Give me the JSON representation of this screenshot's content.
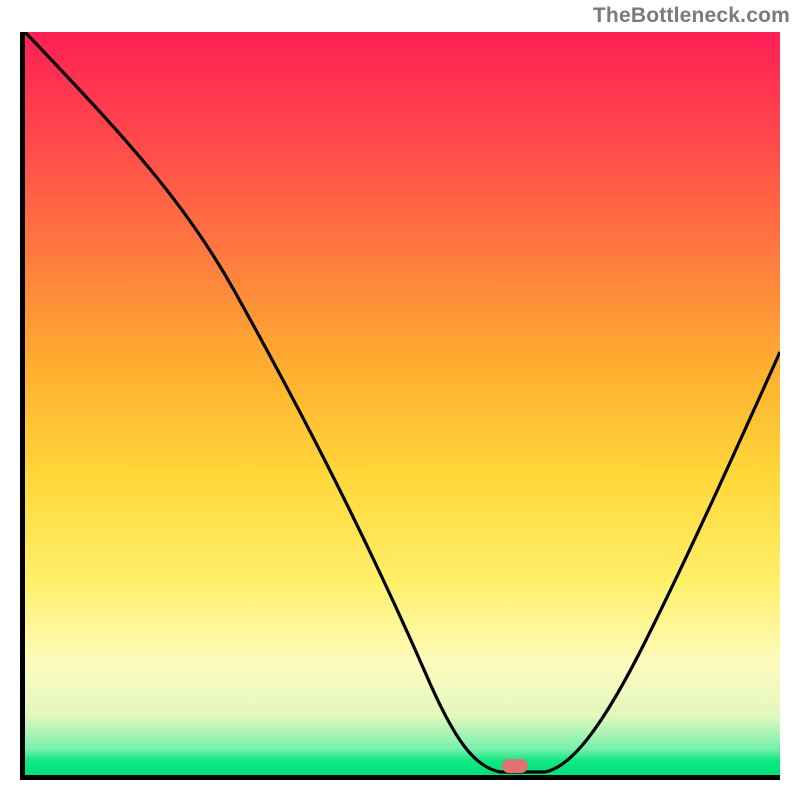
{
  "watermark": "TheBottleneck.com",
  "chart_data": {
    "type": "line",
    "title": "",
    "xlabel": "",
    "ylabel": "",
    "xlim": [
      0,
      100
    ],
    "ylim": [
      0,
      100
    ],
    "x": [
      0,
      10,
      20,
      30,
      40,
      50,
      58,
      62,
      65,
      68,
      72,
      80,
      90,
      100
    ],
    "values": [
      100,
      88,
      76,
      60,
      43,
      26,
      8,
      1,
      0,
      0,
      3,
      18,
      37,
      58
    ],
    "minimum_x_position": 66,
    "background_gradient": {
      "top": "#ff1f55",
      "middle": "#ffd83a",
      "bottom": "#00e07a"
    },
    "marker": {
      "x": 66,
      "y": 0,
      "color": "#e17272"
    }
  }
}
